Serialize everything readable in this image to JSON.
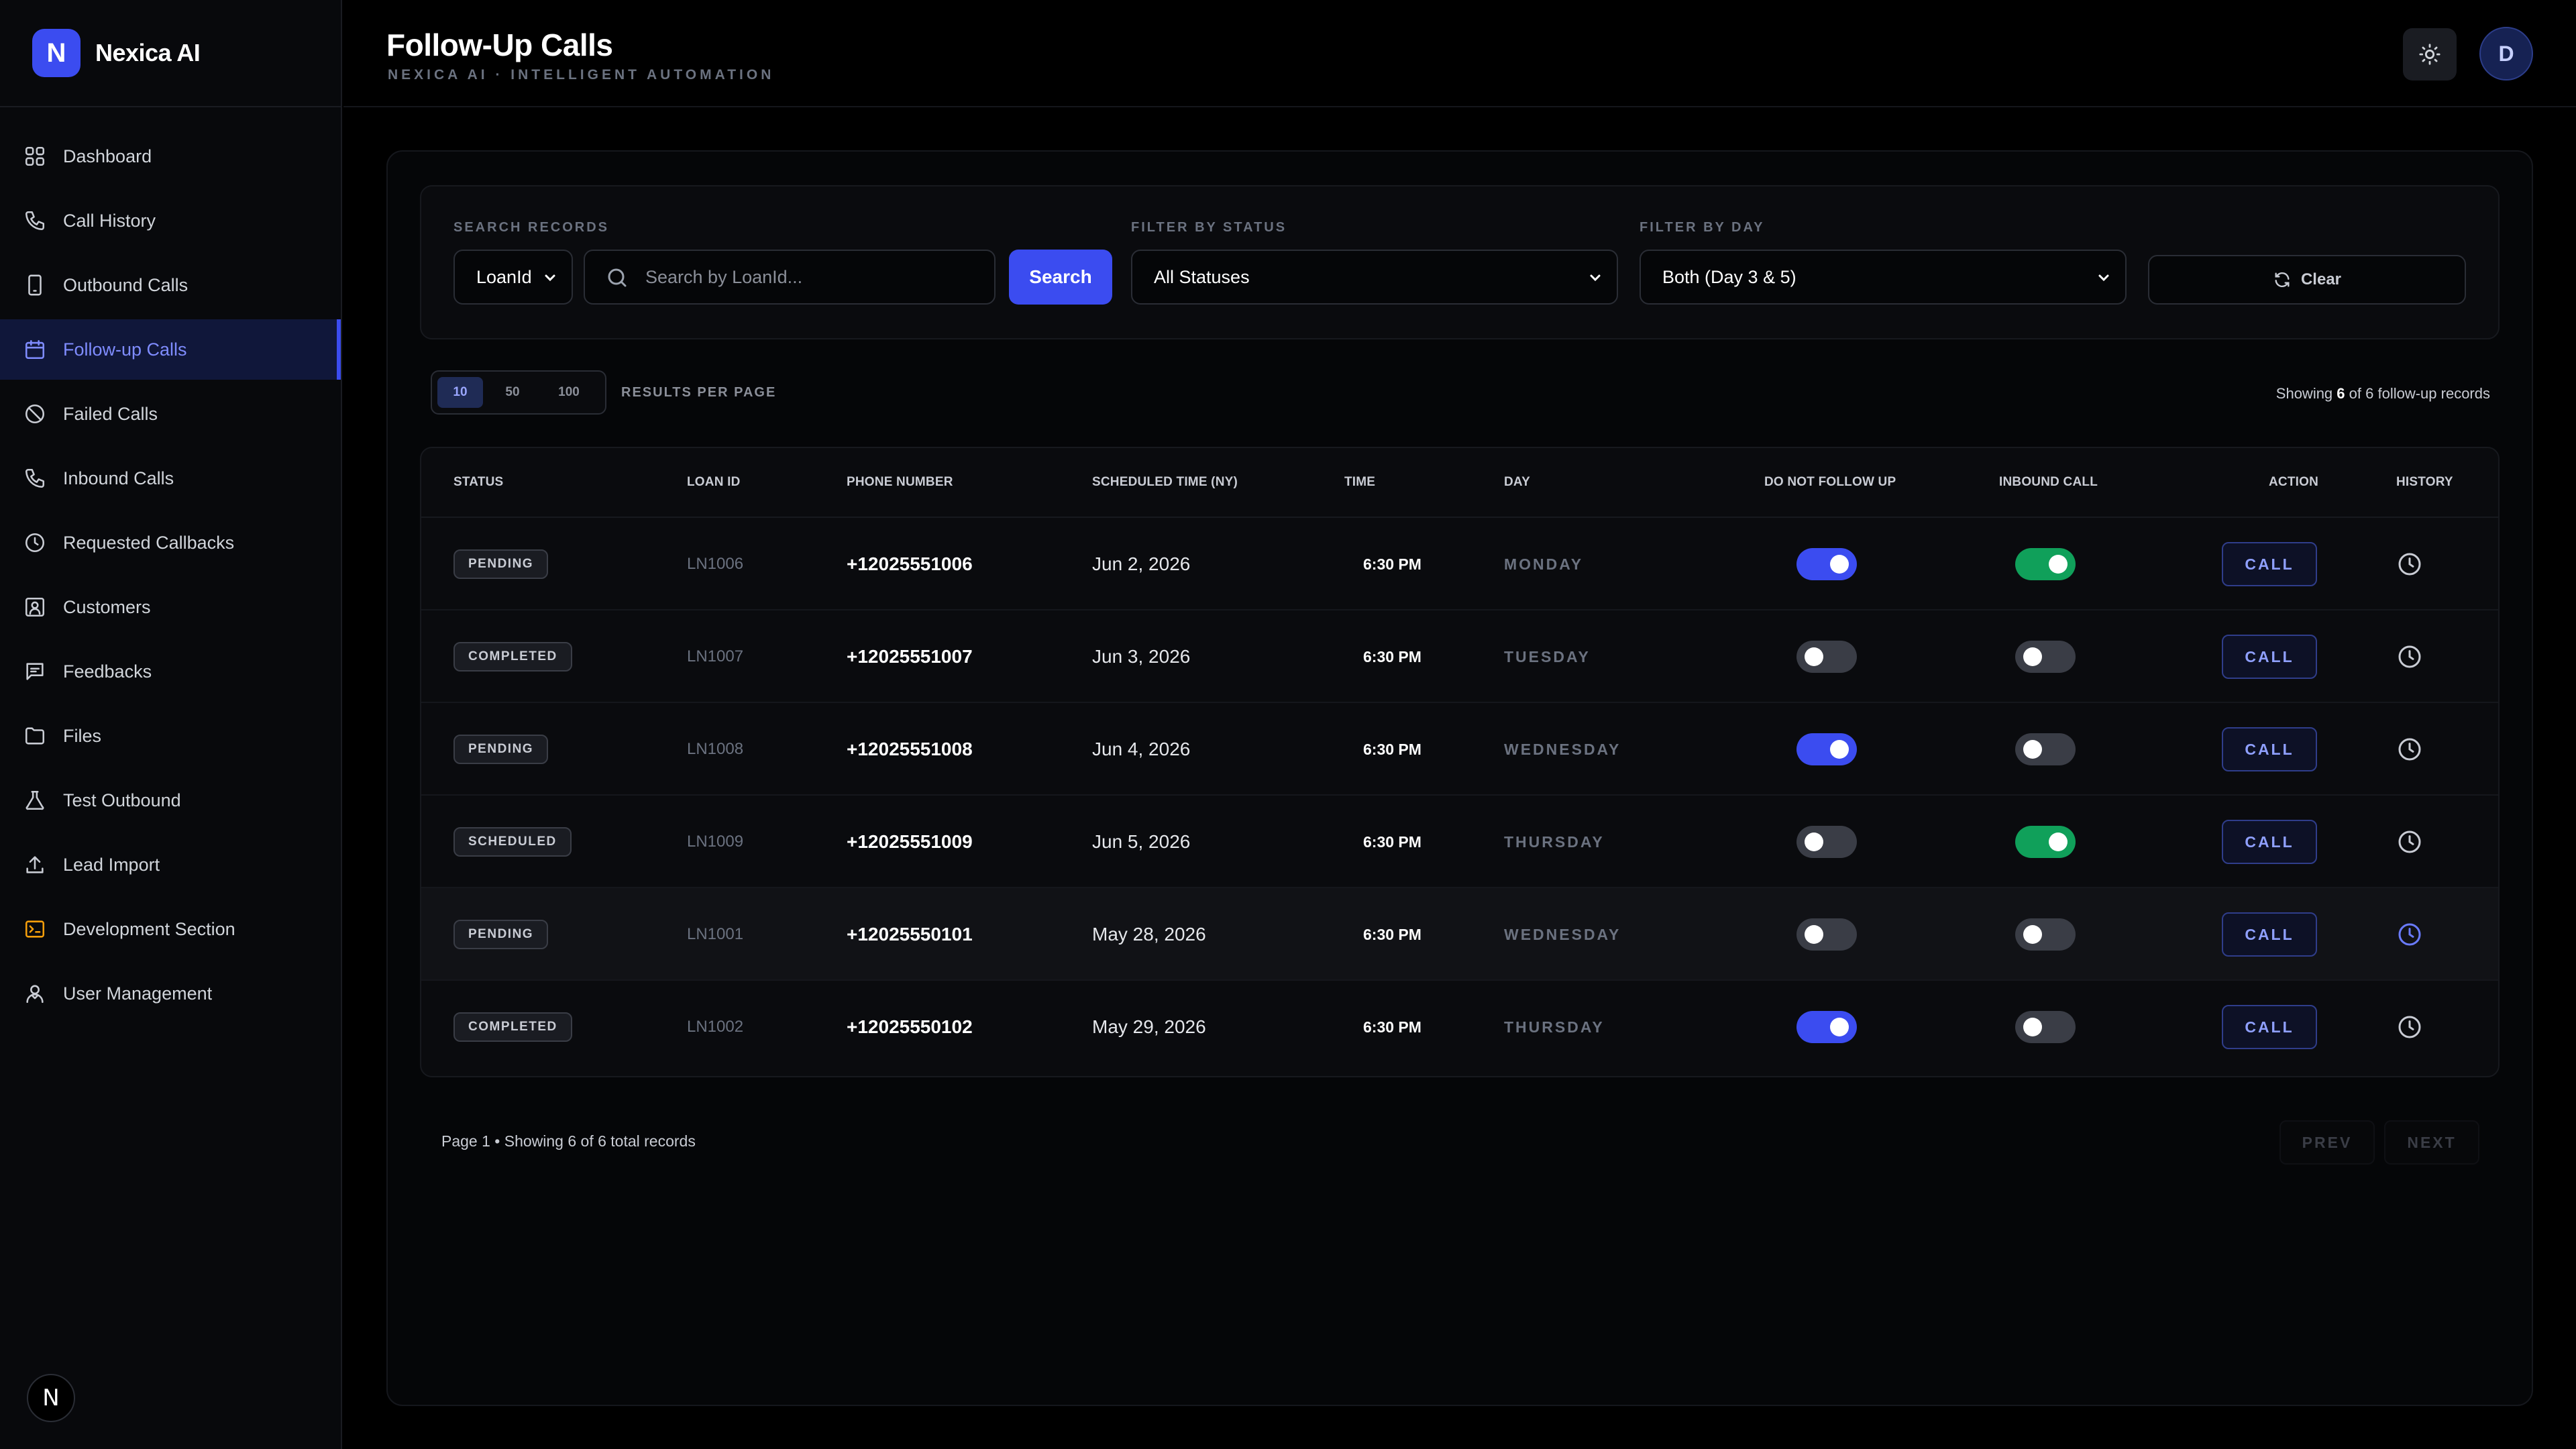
{
  "brand": {
    "logo_letter": "N",
    "name": "Nexica AI"
  },
  "sidebar": {
    "items": [
      {
        "label": "Dashboard",
        "icon": "dashboard-icon"
      },
      {
        "label": "Call History",
        "icon": "phone-icon"
      },
      {
        "label": "Outbound Calls",
        "icon": "mobile-icon"
      },
      {
        "label": "Follow-up Calls",
        "icon": "calendar-icon",
        "active": true
      },
      {
        "label": "Failed Calls",
        "icon": "ban-icon"
      },
      {
        "label": "Inbound Calls",
        "icon": "phone-icon"
      },
      {
        "label": "Requested Callbacks",
        "icon": "clock-icon"
      },
      {
        "label": "Customers",
        "icon": "contact-icon"
      },
      {
        "label": "Feedbacks",
        "icon": "message-icon"
      },
      {
        "label": "Files",
        "icon": "folder-icon"
      },
      {
        "label": "Test Outbound",
        "icon": "flask-icon"
      },
      {
        "label": "Lead Import",
        "icon": "upload-icon"
      },
      {
        "label": "Development Section",
        "icon": "terminal-icon"
      },
      {
        "label": "User Management",
        "icon": "users-icon"
      }
    ],
    "bottom_logo": "N"
  },
  "header": {
    "title": "Follow-Up Calls",
    "subtitle": "NEXICA AI · INTELLIGENT AUTOMATION",
    "avatar_letter": "D"
  },
  "filters": {
    "search_label": "SEARCH RECORDS",
    "search_field": "LoanId",
    "search_placeholder": "Search by LoanId...",
    "search_button": "Search",
    "status_label": "FILTER BY STATUS",
    "status_value": "All Statuses",
    "day_label": "FILTER BY DAY",
    "day_value": "Both (Day 3 & 5)",
    "clear_button": "Clear"
  },
  "pagination": {
    "per_page_options": [
      "10",
      "50",
      "100"
    ],
    "per_page_selected": "10",
    "per_page_label": "RESULTS PER PAGE",
    "showing_prefix": "Showing",
    "showing_count": "6",
    "showing_suffix": "of 6 follow-up records",
    "footer": "Page 1 • Showing 6 of 6 total records",
    "prev": "PREV",
    "next": "NEXT"
  },
  "table": {
    "columns": {
      "status": "STATUS",
      "loanid": "LOAN ID",
      "phone": "PHONE NUMBER",
      "scheduled": "SCHEDULED TIME (NY)",
      "time": "TIME",
      "day": "DAY",
      "dnf": "DO NOT FOLLOW UP",
      "inbound": "INBOUND CALL",
      "action": "ACTION",
      "history": "HISTORY"
    },
    "call_label": "CALL",
    "rows": [
      {
        "status": "PENDING",
        "loanid": "LN1006",
        "phone": "+12025551006",
        "date": "Jun 2, 2026",
        "time": "6:30 PM",
        "day": "MONDAY",
        "dnf": true,
        "inbound": true
      },
      {
        "status": "COMPLETED",
        "loanid": "LN1007",
        "phone": "+12025551007",
        "date": "Jun 3, 2026",
        "time": "6:30 PM",
        "day": "TUESDAY",
        "dnf": false,
        "inbound": false
      },
      {
        "status": "PENDING",
        "loanid": "LN1008",
        "phone": "+12025551008",
        "date": "Jun 4, 2026",
        "time": "6:30 PM",
        "day": "WEDNESDAY",
        "dnf": true,
        "inbound": false
      },
      {
        "status": "SCHEDULED",
        "loanid": "LN1009",
        "phone": "+12025551009",
        "date": "Jun 5, 2026",
        "time": "6:30 PM",
        "day": "THURSDAY",
        "dnf": false,
        "inbound": true
      },
      {
        "status": "PENDING",
        "loanid": "LN1001",
        "phone": "+12025550101",
        "date": "May 28, 2026",
        "time": "6:30 PM",
        "day": "WEDNESDAY",
        "dnf": false,
        "inbound": false,
        "highlighted": true
      },
      {
        "status": "COMPLETED",
        "loanid": "LN1002",
        "phone": "+12025550102",
        "date": "May 29, 2026",
        "time": "6:30 PM",
        "day": "THURSDAY",
        "dnf": true,
        "inbound": false
      }
    ]
  },
  "colors": {
    "accent": "#3b4cf0",
    "toggle_blue": "#3b4cf0",
    "toggle_green": "#10a05a",
    "background": "#000000"
  }
}
